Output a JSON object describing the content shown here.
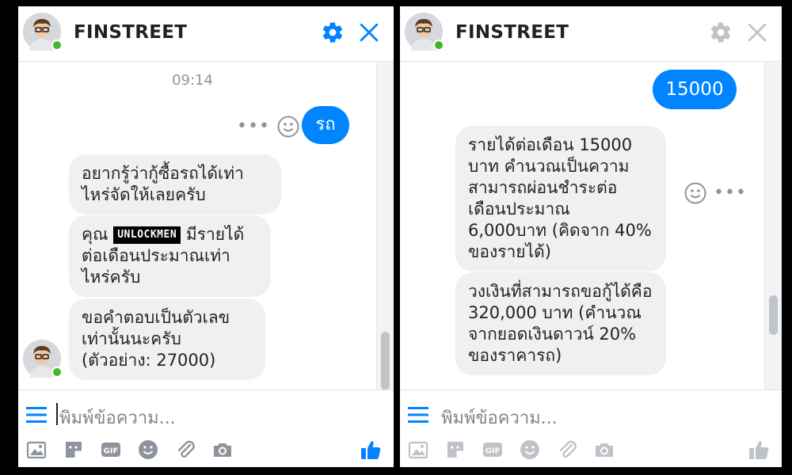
{
  "left_window": {
    "header": {
      "title": "FINSTREET",
      "status": "online"
    },
    "timestamp": "09:14",
    "sent_message": "รถ",
    "received_messages": [
      "อยากรู้ว่ากู้ซื้อรถได้เท่าไหร่จัดให้เลยครับ",
      {
        "prefix": "คุณ",
        "badge": "UNLOCKMEN",
        "suffix": "มีรายได้ต่อเดือนประมาณเท่าไหร่ครับ"
      },
      "ขอคำตอบเป็นตัวเลขเท่านั้นนะครับ (ตัวอย่าง: 27000)"
    ],
    "composer": {
      "placeholder": "พิมพ์ข้อความ..."
    },
    "accent_color": "#0084ff"
  },
  "right_window": {
    "header": {
      "title": "FINSTREET",
      "status": "online"
    },
    "sent_message": "15000",
    "received_messages": [
      "รายได้ต่อเดือน 15000 บาท คำนวณเป็นความสามารถผ่อนชำระต่อเดือนประมาณ 6,000บาท (คิดจาก 40% ของรายได้)",
      "วงเงินที่สามารถขอกู้ได้คือ 320,000 บาท (คำนวณจากยอดเงินดาวน์ 20% ของราคารถ)"
    ],
    "composer": {
      "placeholder": "พิมพ์ข้อความ..."
    },
    "accent_color": "#bec3c9"
  },
  "icons": [
    "gear-icon",
    "close-icon",
    "menu-icon",
    "image-icon",
    "sticker-icon",
    "gif-icon",
    "emoji-icon",
    "attachment-icon",
    "camera-icon",
    "thumbs-up-icon",
    "smile-icon",
    "more-icon"
  ]
}
